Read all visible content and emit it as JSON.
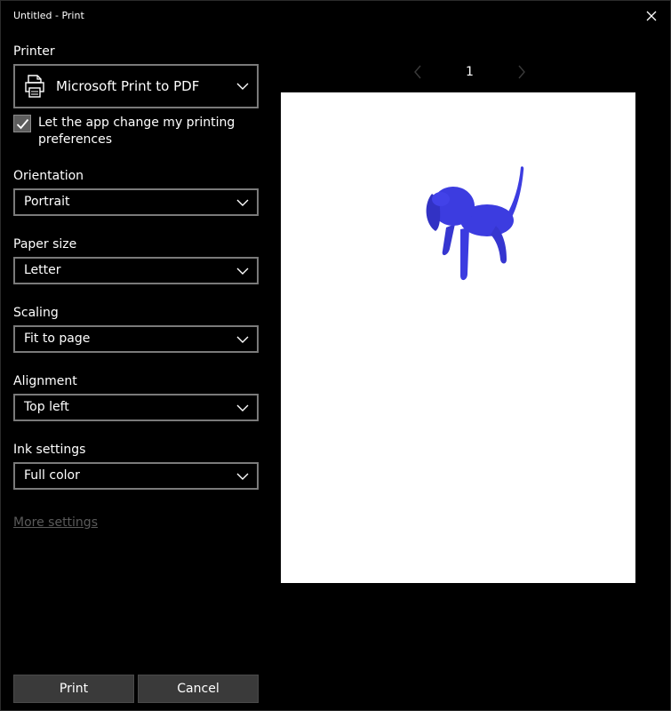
{
  "window": {
    "title": "Untitled - Print"
  },
  "printer": {
    "label": "Printer",
    "value": "Microsoft Print to PDF"
  },
  "preferences_checkbox": {
    "label": "Let the app change my printing preferences",
    "checked": true
  },
  "orientation": {
    "label": "Orientation",
    "value": "Portrait"
  },
  "paper_size": {
    "label": "Paper size",
    "value": "Letter"
  },
  "scaling": {
    "label": "Scaling",
    "value": "Fit to page"
  },
  "alignment": {
    "label": "Alignment",
    "value": "Top left"
  },
  "ink_settings": {
    "label": "Ink settings",
    "value": "Full color"
  },
  "more_settings": {
    "label": "More settings"
  },
  "preview": {
    "page_number": "1"
  },
  "buttons": {
    "print": "Print",
    "cancel": "Cancel"
  },
  "colors": {
    "background": "#000000",
    "dropdown_border": "#7a7a7a",
    "dog": "#3c3ce0",
    "button_bg": "#3a3a3a"
  },
  "icons": [
    "close-icon",
    "printer-icon",
    "chevron-down-icon",
    "checkmark-icon",
    "chevron-left-icon",
    "chevron-right-icon"
  ]
}
